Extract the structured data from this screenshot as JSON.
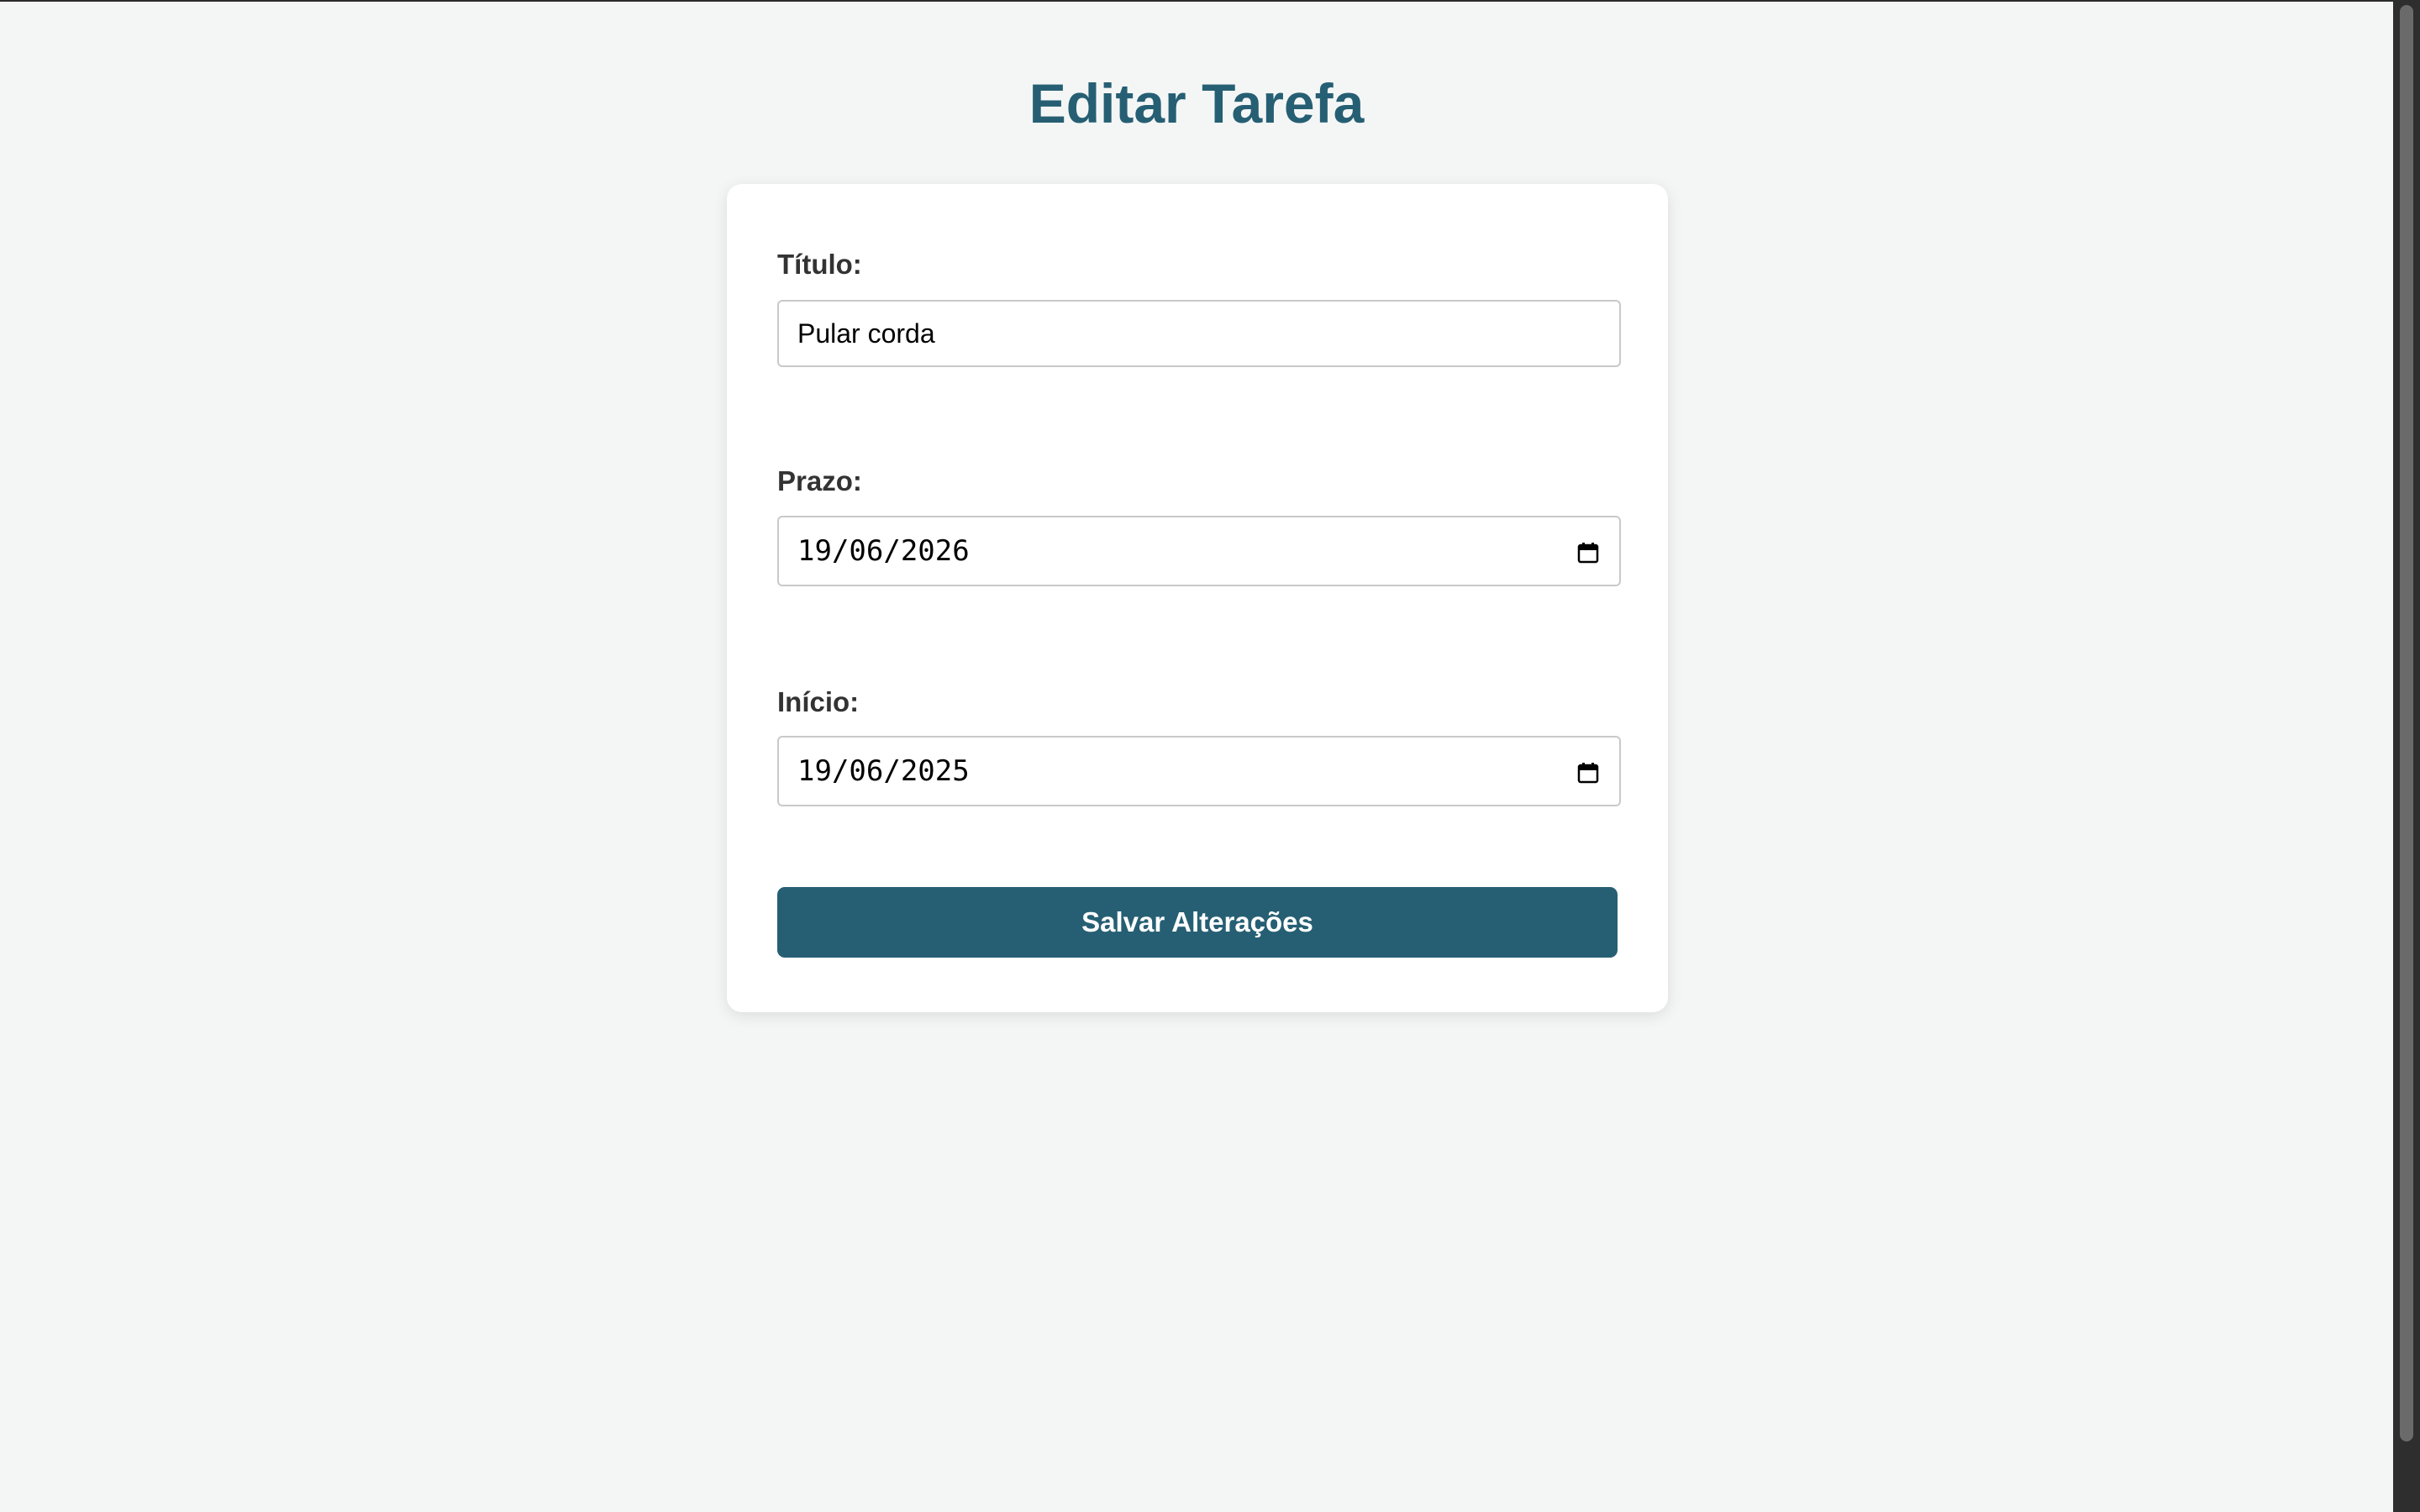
{
  "page": {
    "title": "Editar Tarefa"
  },
  "form": {
    "title_label": "Título:",
    "title_value": "Pular corda",
    "deadline_label": "Prazo:",
    "deadline_value": "19/06/2026",
    "start_label": "Início:",
    "start_value": "19/06/2025",
    "save_label": "Salvar Alterações"
  },
  "icons": {
    "date_picker": "calendar-icon"
  },
  "colors": {
    "accent": "#265f73",
    "background": "#f4f6f6",
    "card": "#ffffff",
    "label_text": "#333333"
  }
}
